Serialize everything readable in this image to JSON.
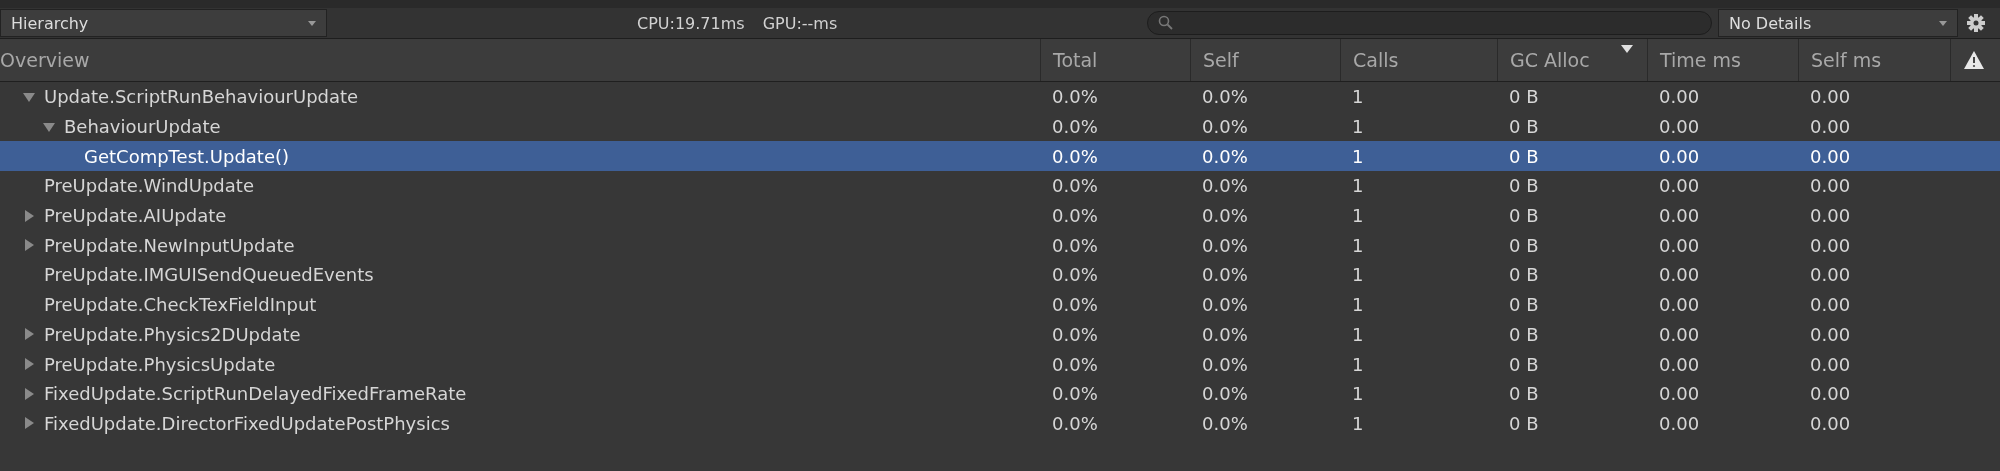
{
  "toolbar": {
    "view_dropdown": "Hierarchy",
    "cpu": "CPU:19.71ms",
    "gpu": "GPU:--ms",
    "details_dropdown": "No Details"
  },
  "table": {
    "columns": [
      {
        "label": "Overview",
        "sorted": false
      },
      {
        "label": "Total",
        "sorted": false
      },
      {
        "label": "Self",
        "sorted": false
      },
      {
        "label": "Calls",
        "sorted": false
      },
      {
        "label": "GC Alloc",
        "sorted": true
      },
      {
        "label": "Time ms",
        "sorted": false
      },
      {
        "label": "Self ms",
        "sorted": false
      }
    ],
    "rows": [
      {
        "name": "Update.ScriptRunBehaviourUpdate",
        "expanded": true,
        "selected": false,
        "values": [
          "0.0%",
          "0.0%",
          "1",
          "0 B",
          "0.00",
          "0.00"
        ],
        "children": [
          {
            "name": "BehaviourUpdate",
            "expanded": true,
            "selected": false,
            "values": [
              "0.0%",
              "0.0%",
              "1",
              "0 B",
              "0.00",
              "0.00"
            ],
            "children": [
              {
                "name": "GetCompTest.Update()",
                "selected": true,
                "values": [
                  "0.0%",
                  "0.0%",
                  "1",
                  "0 B",
                  "0.00",
                  "0.00"
                ]
              }
            ]
          }
        ]
      },
      {
        "name": "PreUpdate.WindUpdate",
        "selected": false,
        "values": [
          "0.0%",
          "0.0%",
          "1",
          "0 B",
          "0.00",
          "0.00"
        ]
      },
      {
        "name": "PreUpdate.AIUpdate",
        "expanded": false,
        "selected": false,
        "values": [
          "0.0%",
          "0.0%",
          "1",
          "0 B",
          "0.00",
          "0.00"
        ]
      },
      {
        "name": "PreUpdate.NewInputUpdate",
        "expanded": false,
        "selected": false,
        "values": [
          "0.0%",
          "0.0%",
          "1",
          "0 B",
          "0.00",
          "0.00"
        ]
      },
      {
        "name": "PreUpdate.IMGUISendQueuedEvents",
        "selected": false,
        "values": [
          "0.0%",
          "0.0%",
          "1",
          "0 B",
          "0.00",
          "0.00"
        ]
      },
      {
        "name": "PreUpdate.CheckTexFieldInput",
        "selected": false,
        "values": [
          "0.0%",
          "0.0%",
          "1",
          "0 B",
          "0.00",
          "0.00"
        ]
      },
      {
        "name": "PreUpdate.Physics2DUpdate",
        "expanded": false,
        "selected": false,
        "values": [
          "0.0%",
          "0.0%",
          "1",
          "0 B",
          "0.00",
          "0.00"
        ]
      },
      {
        "name": "PreUpdate.PhysicsUpdate",
        "expanded": false,
        "selected": false,
        "values": [
          "0.0%",
          "0.0%",
          "1",
          "0 B",
          "0.00",
          "0.00"
        ]
      },
      {
        "name": "FixedUpdate.ScriptRunDelayedFixedFrameRate",
        "expanded": false,
        "selected": false,
        "values": [
          "0.0%",
          "0.0%",
          "1",
          "0 B",
          "0.00",
          "0.00"
        ]
      },
      {
        "name": "FixedUpdate.DirectorFixedUpdatePostPhysics",
        "expanded": false,
        "selected": false,
        "values": [
          "0.0%",
          "0.0%",
          "1",
          "0 B",
          "0.00",
          "0.00"
        ]
      }
    ]
  }
}
